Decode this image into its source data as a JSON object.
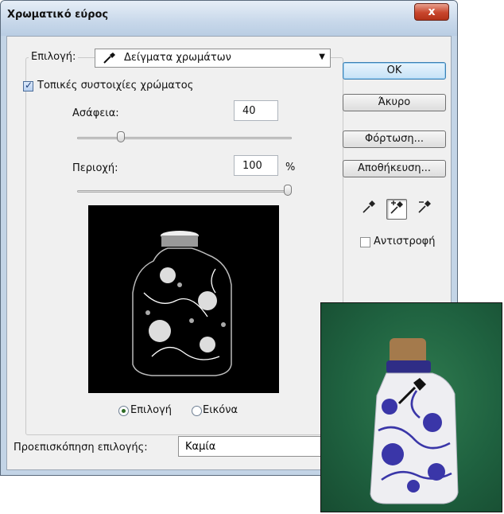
{
  "window": {
    "title": "Χρωματικό εύρος",
    "close_label": "x"
  },
  "selection": {
    "label": "Επιλογή:",
    "value": "Δείγματα χρωμάτων",
    "icon": "eyedropper-icon"
  },
  "local_clusters": {
    "label": "Τοπικές συστοιχίες χρώματος",
    "checked": true
  },
  "fuzziness": {
    "label": "Ασάφεια:",
    "value": "40"
  },
  "range": {
    "label": "Περιοχή:",
    "value": "100",
    "unit": "%"
  },
  "preview_mode": {
    "options": [
      {
        "label": "Επιλογή",
        "selected": true
      },
      {
        "label": "Εικόνα",
        "selected": false
      }
    ]
  },
  "buttons": {
    "ok": "OK",
    "cancel": "Άκυρο",
    "load": "Φόρτωση...",
    "save": "Αποθήκευση..."
  },
  "tools": [
    "eyedropper-icon",
    "eyedropper-plus-icon",
    "eyedropper-minus-icon"
  ],
  "invert": {
    "label": "Αντιστροφή",
    "checked": false
  },
  "selection_preview": {
    "label": "Προεπισκόπηση επιλογής:",
    "value": "Καμία"
  },
  "colors": {
    "title_bar": "#c8d8ea",
    "dialog_bg": "#f0f0f0",
    "close_button": "#c8452c",
    "preview_bg": "#000000",
    "photo_bg": "#1f6240",
    "bottle_blue": "#3a36a8"
  }
}
